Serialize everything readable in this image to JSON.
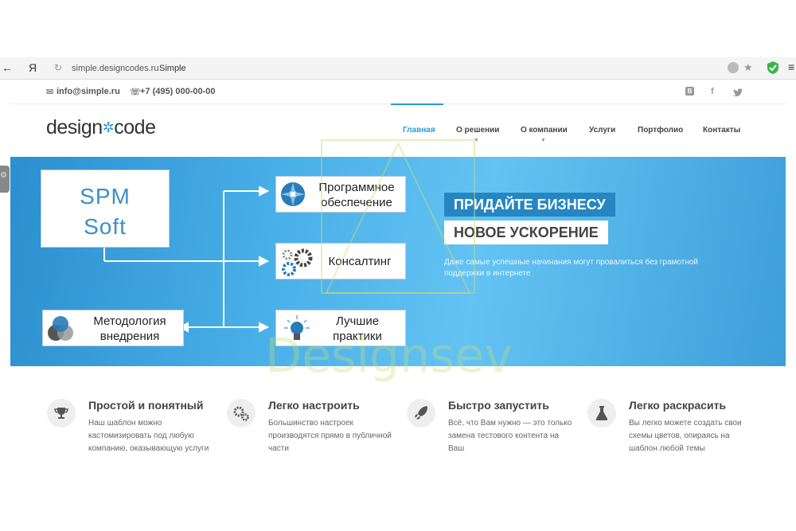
{
  "browser": {
    "back": "←",
    "brand": "Я",
    "reload": "↻",
    "url": "simple.designcodes.ru",
    "tab_title": "Simple"
  },
  "contact": {
    "email": "info@simple.ru",
    "phone": "+7 (495) 000-00-00",
    "social": [
      "В",
      "f",
      "t"
    ]
  },
  "header": {
    "logo_left": "design",
    "logo_right": "code",
    "nav": [
      {
        "label": "Главная",
        "active": true
      },
      {
        "label": "О решении"
      },
      {
        "label": "О компании"
      },
      {
        "label": "Услуги"
      },
      {
        "label": "Портфолио"
      },
      {
        "label": "Контакты"
      }
    ]
  },
  "hero": {
    "main_box": [
      "SPM",
      "Soft"
    ],
    "boxes": {
      "software": [
        "Программное",
        "обеспечение"
      ],
      "consulting": [
        "Консалтинг"
      ],
      "methodology": [
        "Методология",
        "внедрения"
      ],
      "practices": [
        "Лучшие",
        "практики"
      ]
    },
    "headline_1": "ПРИДАЙТЕ БИЗНЕСУ",
    "headline_2": "НОВОЕ УСКОРЕНИЕ",
    "subtitle": "Даже самые успешные начинания могут провалиться без грамотной поддержки в интернете",
    "colors": {
      "headline_1_bg": "#2586c2",
      "headline_2_bg": "#ffffff"
    }
  },
  "features": [
    {
      "icon": "trophy-icon",
      "title": "Простой и понятный",
      "text": "Наш шаблон можно кастомизировать под любую компанию, оказывающую услуги"
    },
    {
      "icon": "gears-icon",
      "title": "Легко настроить",
      "text": "Большинство настроек производятся прямо в публичной части"
    },
    {
      "icon": "rocket-icon",
      "title": "Быстро запустить",
      "text": "Всё, что Вам нужно — это только замена тестового контента на Ваш"
    },
    {
      "icon": "flask-icon",
      "title": "Легко раскрасить",
      "text": "Вы легко можете создать свои схемы цветов, опираясь на шаблон любой темы"
    }
  ],
  "watermark": "Designsev"
}
